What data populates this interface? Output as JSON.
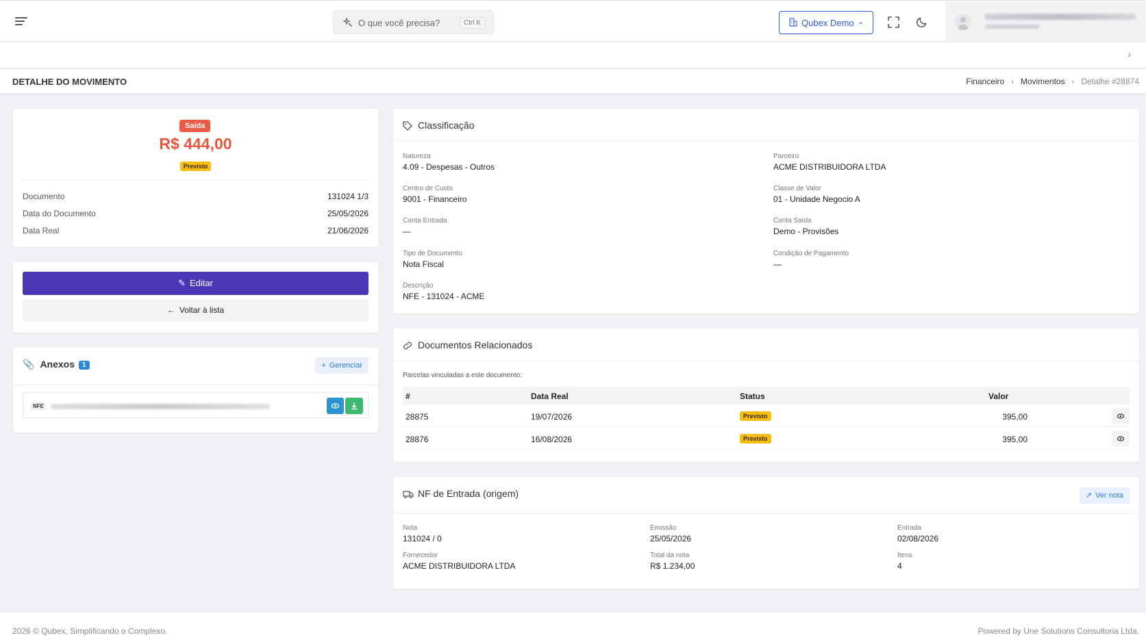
{
  "topbar": {
    "search_placeholder": "O que você precisa?",
    "search_shortcut": "Ctrl K",
    "company_label": "Qubex Demo"
  },
  "page": {
    "title": "DETALHE DO MOVIMENTO",
    "breadcrumb": [
      "Financeiro",
      "Movimentos",
      "Detalhe #28874"
    ]
  },
  "summary": {
    "type_badge": "Saída",
    "amount": "R$ 444,00",
    "status_badge": "Previsto",
    "rows": [
      {
        "label": "Documento",
        "value": "131024 1/3"
      },
      {
        "label": "Data do Documento",
        "value": "25/05/2026"
      },
      {
        "label": "Data Real",
        "value": "21/06/2026"
      }
    ]
  },
  "actions": {
    "edit_label": "Editar",
    "back_label": "Voltar à lista"
  },
  "attachments": {
    "title": "Anexos",
    "count": "1",
    "manage_label": "Gerenciar",
    "items": [
      {
        "tag": "NFE"
      }
    ]
  },
  "classification": {
    "title": "Classificação",
    "fields": [
      {
        "label": "Natureza",
        "value": "4.09 - Despesas - Outros"
      },
      {
        "label": "Parceiro",
        "value": "ACME DISTRIBUIDORA LTDA"
      },
      {
        "label": "Centro de Custo",
        "value": "9001 - Financeiro"
      },
      {
        "label": "Classe de Valor",
        "value": "01 - Unidade Negocio A"
      },
      {
        "label": "Conta Entrada",
        "value": "—"
      },
      {
        "label": "Conta Saída",
        "value": "Demo - Provisões"
      },
      {
        "label": "Tipo de Documento",
        "value": "Nota Fiscal"
      },
      {
        "label": "Condição de Pagamento",
        "value": "—"
      },
      {
        "label": "Descrição",
        "value": "NFE - 131024 - ACME"
      }
    ]
  },
  "related": {
    "title": "Documentos Relacionados",
    "subtitle": "Parcelas vinculadas a este documento:",
    "columns": [
      "#",
      "Data Real",
      "Status",
      "Valor"
    ],
    "rows": [
      {
        "id": "28875",
        "date": "19/07/2026",
        "status": "Previsto",
        "value": "395,00"
      },
      {
        "id": "28876",
        "date": "16/08/2026",
        "status": "Previsto",
        "value": "395,00"
      }
    ]
  },
  "nf": {
    "title": "NF de Entrada (origem)",
    "view_label": "Ver nota",
    "fields": [
      {
        "label": "Nota",
        "value": "131024 / 0"
      },
      {
        "label": "Emissão",
        "value": "25/05/2026"
      },
      {
        "label": "Entrada",
        "value": "02/08/2026"
      },
      {
        "label": "Fornecedor",
        "value": "ACME DISTRIBUIDORA LTDA"
      },
      {
        "label": "Total da nota",
        "value": "R$ 1.234,00"
      },
      {
        "label": "Itens",
        "value": "4"
      }
    ]
  },
  "footer": {
    "left": "2026 © Qubex, Simplificando o Complexo.",
    "right": "Powered by Une Solutions Consultoria Ltda."
  }
}
